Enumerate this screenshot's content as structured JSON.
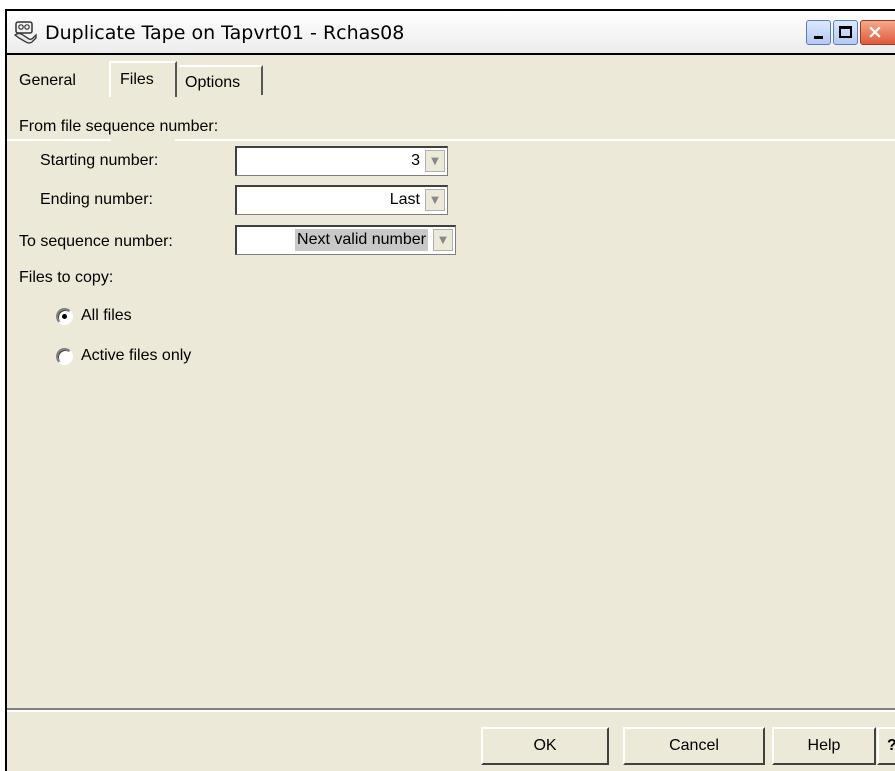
{
  "window": {
    "title": "Duplicate Tape on Tapvrt01 - Rchas08",
    "icon": "tape-drive-icon"
  },
  "tabs": [
    {
      "label": "General",
      "selected": false
    },
    {
      "label": "Files",
      "selected": true
    },
    {
      "label": "Options",
      "selected": false
    }
  ],
  "form": {
    "from_file_sequence_label": "From file sequence number:",
    "starting_number_label": "Starting number:",
    "starting_number_value": "3",
    "ending_number_label": "Ending number:",
    "ending_number_value": "Last",
    "to_sequence_label": "To sequence number:",
    "to_sequence_value": "Next valid number",
    "files_to_copy_label": "Files to copy:",
    "options": [
      {
        "label": "All files",
        "checked": true
      },
      {
        "label": "Active files only",
        "checked": false
      }
    ]
  },
  "buttons": {
    "ok": "OK",
    "cancel": "Cancel",
    "help": "Help",
    "whats_this": "?"
  }
}
